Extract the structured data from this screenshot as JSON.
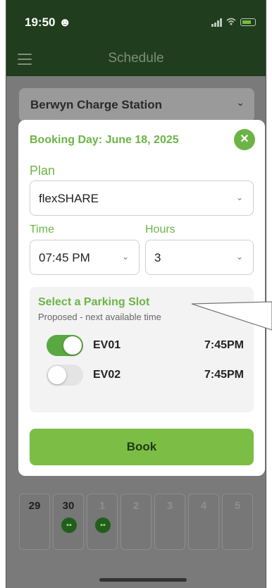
{
  "status_bar": {
    "time": "19:50",
    "status_emoji": "☻"
  },
  "app_bar": {
    "title": "Schedule"
  },
  "station": {
    "name": "Berwyn Charge Station"
  },
  "modal": {
    "booking_day": "Booking Day: June 18, 2025",
    "close_icon": "✕",
    "plan_label": "Plan",
    "plan_value": "flexSHARE",
    "time_label": "Time",
    "time_value": "07:45 PM",
    "hours_label": "Hours",
    "hours_value": "3",
    "slot_title": "Select a Parking Slot",
    "slot_subtitle": "Proposed - next available time",
    "slots": [
      {
        "name": "EV01",
        "time": "7:45PM",
        "selected": true
      },
      {
        "name": "EV02",
        "time": "7:45PM",
        "selected": false
      }
    ],
    "book_label": "Book"
  },
  "calendar": {
    "days": [
      {
        "num": "29",
        "dim": false,
        "badge": false
      },
      {
        "num": "30",
        "dim": false,
        "badge": true
      },
      {
        "num": "1",
        "dim": true,
        "badge": true
      },
      {
        "num": "2",
        "dim": true,
        "badge": false
      },
      {
        "num": "3",
        "dim": true,
        "badge": false
      },
      {
        "num": "4",
        "dim": true,
        "badge": false
      },
      {
        "num": "5",
        "dim": true,
        "badge": false
      }
    ]
  },
  "icons": {
    "menu": "hamburger-icon",
    "chevron": "chevron-down-icon",
    "close": "close-icon",
    "charger": "charger-icon"
  },
  "colors": {
    "header": "#203d1d",
    "accent": "#6cb446",
    "book_button": "#7cbe45",
    "toggle_on": "#5aa842"
  }
}
